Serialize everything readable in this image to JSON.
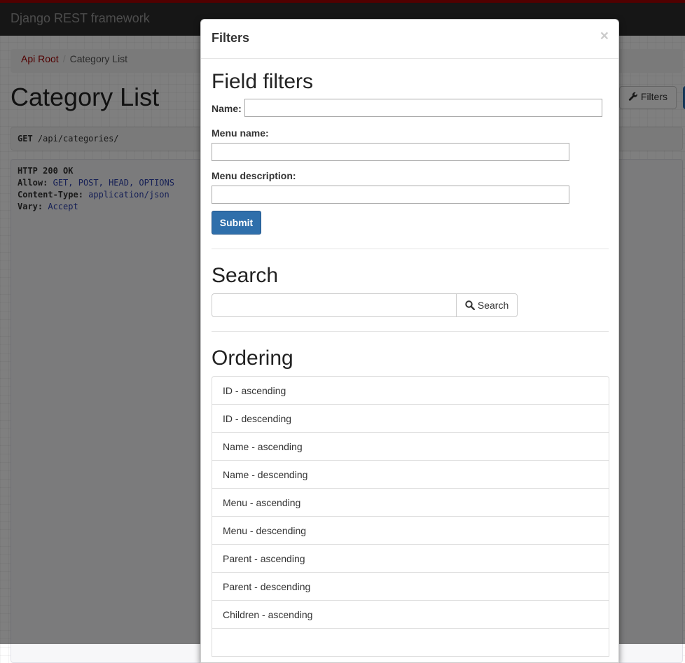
{
  "navbar": {
    "brand": "Django REST framework"
  },
  "breadcrumb": {
    "root": "Api Root",
    "separator": "/",
    "current": "Category List"
  },
  "page": {
    "title": "Category List",
    "filters_button": "Filters"
  },
  "request": {
    "method": "GET",
    "path": "/api/categories/"
  },
  "response": {
    "status": "HTTP 200 OK",
    "headers": [
      {
        "name": "Allow:",
        "value": "GET, POST, HEAD, OPTIONS"
      },
      {
        "name": "Content-Type:",
        "value": "application/json"
      },
      {
        "name": "Vary:",
        "value": "Accept"
      }
    ]
  },
  "modal": {
    "title": "Filters",
    "close": "×",
    "field_filters": {
      "title": "Field filters",
      "fields": [
        {
          "label": "Name:",
          "value": ""
        },
        {
          "label": "Menu name:",
          "value": ""
        },
        {
          "label": "Menu description:",
          "value": ""
        }
      ],
      "submit": "Submit"
    },
    "search": {
      "title": "Search",
      "value": "",
      "button": "Search"
    },
    "ordering": {
      "title": "Ordering",
      "items": [
        "ID - ascending",
        "ID - descending",
        "Name - ascending",
        "Name - descending",
        "Menu - ascending",
        "Menu - descending",
        "Parent - ascending",
        "Parent - descending",
        "Children - ascending",
        ""
      ]
    }
  },
  "colors": {
    "navbar_bg": "#2c2c2c",
    "brand_accent": "#a30000",
    "primary_button": "#2f6fab",
    "json_literal": "#2a3fab",
    "json_string": "#a30000"
  }
}
